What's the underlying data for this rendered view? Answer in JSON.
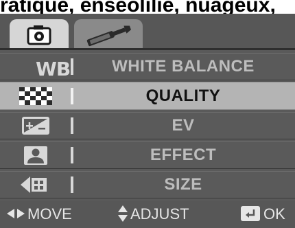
{
  "caption": "ratique, enseolilie, nuageux,",
  "tabs": [
    {
      "icon": "camera-icon",
      "active": true
    },
    {
      "icon": "tools-icon",
      "active": false
    }
  ],
  "menu": {
    "items": [
      {
        "icon": "white-balance-icon",
        "icon_text": "WB",
        "label": "WHITE BALANCE",
        "selected": false
      },
      {
        "icon": "quality-icon",
        "label": "QUALITY",
        "selected": true
      },
      {
        "icon": "ev-icon",
        "label": "EV",
        "selected": false
      },
      {
        "icon": "effect-icon",
        "label": "EFFECT",
        "selected": false
      },
      {
        "icon": "size-icon",
        "label": "SIZE",
        "selected": false
      }
    ]
  },
  "hints": {
    "move_label": "MOVE",
    "adjust_label": "ADJUST",
    "ok_label": "OK"
  },
  "colors": {
    "panel": "#5a5a5a",
    "selected_row": "#b4b4b4",
    "active_tab": "#d6d6d6",
    "inactive_tab": "#8a8a8a",
    "text": "#bdbdbd"
  }
}
